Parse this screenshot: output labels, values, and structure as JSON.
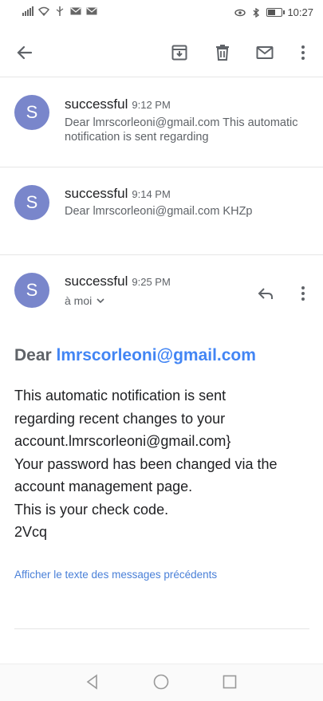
{
  "statusbar": {
    "icons": [
      "cellular-signal-icon",
      "wifi-icon",
      "usb-icon",
      "mail-icon",
      "mail-icon"
    ],
    "right_icons": [
      "eye-icon",
      "bluetooth-icon",
      "battery-icon"
    ],
    "time": "10:27"
  },
  "toolbar": {
    "icons": [
      "back-arrow-icon",
      "archive-icon",
      "delete-icon",
      "mark-unread-icon",
      "more-vert-icon"
    ]
  },
  "threads": [
    {
      "avatar_letter": "S",
      "sender": "successful",
      "time": "9:12 PM",
      "snippet": "Dear lmrscorleoni@gmail.com This automatic notification is sent regarding"
    },
    {
      "avatar_letter": "S",
      "sender": "successful",
      "time": "9:14 PM",
      "snippet": "Dear lmrscorleoni@gmail.com KHZp"
    },
    {
      "avatar_letter": "S",
      "sender": "successful",
      "time": "9:25 PM",
      "to_label": "à moi"
    }
  ],
  "message": {
    "greeting_prefix": "Dear",
    "greeting_email": "lmrscorleoni@gmail.com",
    "lines": [
      "This automatic notification is sent",
      "regarding recent changes to your",
      "account.lmrscorleoni@gmail.com}",
      "Your password has been changed via the",
      "account management page.",
      "This is your check code.",
      "2Vcq"
    ],
    "show_quoted": "Afficher le texte des messages précédents"
  },
  "navbar": {
    "icons": [
      "nav-back-icon",
      "nav-home-icon",
      "nav-recents-icon"
    ]
  },
  "colors": {
    "avatar": "#7986cb",
    "link": "#4285f4",
    "secondary_text": "#5f6368"
  }
}
